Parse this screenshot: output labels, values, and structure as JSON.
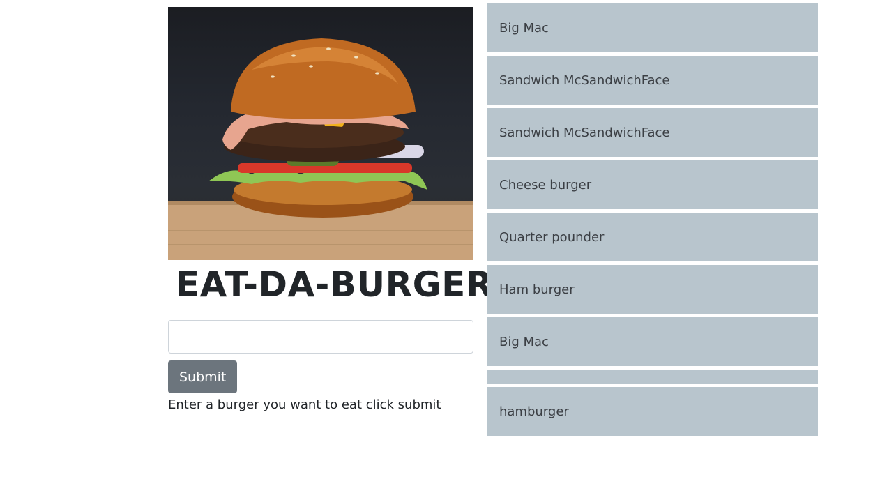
{
  "page": {
    "title": "EAT-DA-BURGER",
    "hero_image": "burger-photo"
  },
  "form": {
    "input_value": "",
    "input_placeholder": "",
    "submit_label": "Submit",
    "hint": "Enter a burger you want to eat click submit"
  },
  "burgers": [
    {
      "name": "Big Mac"
    },
    {
      "name": "Sandwich McSandwichFace"
    },
    {
      "name": "Sandwich McSandwichFace"
    },
    {
      "name": "Cheese burger"
    },
    {
      "name": "Quarter pounder"
    },
    {
      "name": "Ham burger"
    },
    {
      "name": "Big Mac"
    },
    {
      "name": ""
    },
    {
      "name": "hamburger"
    }
  ],
  "colors": {
    "list_item_bg": "#b8c5cd",
    "button_bg": "#6c757d",
    "title_text": "#212529"
  }
}
